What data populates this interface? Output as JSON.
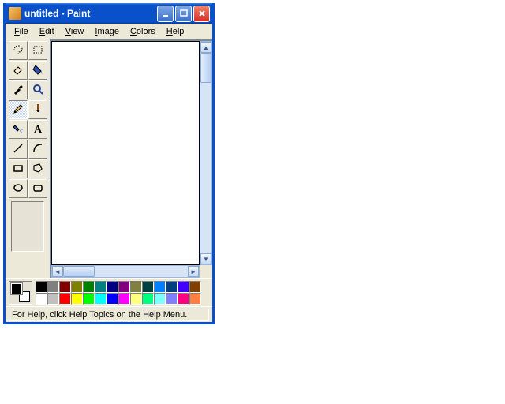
{
  "window": {
    "title": "untitled - Paint"
  },
  "menus": [
    {
      "label": "File",
      "key": "F"
    },
    {
      "label": "Edit",
      "key": "E"
    },
    {
      "label": "View",
      "key": "V"
    },
    {
      "label": "Image",
      "key": "I"
    },
    {
      "label": "Colors",
      "key": "C"
    },
    {
      "label": "Help",
      "key": "H"
    }
  ],
  "tools": [
    {
      "name": "free-form-select"
    },
    {
      "name": "select"
    },
    {
      "name": "eraser"
    },
    {
      "name": "fill"
    },
    {
      "name": "pick-color"
    },
    {
      "name": "magnifier"
    },
    {
      "name": "pencil",
      "selected": true
    },
    {
      "name": "brush"
    },
    {
      "name": "airbrush"
    },
    {
      "name": "text"
    },
    {
      "name": "line"
    },
    {
      "name": "curve"
    },
    {
      "name": "rectangle"
    },
    {
      "name": "polygon"
    },
    {
      "name": "ellipse"
    },
    {
      "name": "rounded-rectangle"
    }
  ],
  "palette": {
    "foreground": "#000000",
    "background": "#ffffff",
    "row1": [
      "#000000",
      "#808080",
      "#800000",
      "#808000",
      "#008000",
      "#008080",
      "#000080",
      "#800080",
      "#808040",
      "#004040",
      "#0080ff",
      "#004080",
      "#4000ff",
      "#804000"
    ],
    "row2": [
      "#ffffff",
      "#c0c0c0",
      "#ff0000",
      "#ffff00",
      "#00ff00",
      "#00ffff",
      "#0000ff",
      "#ff00ff",
      "#ffff80",
      "#00ff80",
      "#80ffff",
      "#8080ff",
      "#ff0080",
      "#ff8040"
    ]
  },
  "statusbar": {
    "text": "For Help, click Help Topics on the Help Menu."
  }
}
